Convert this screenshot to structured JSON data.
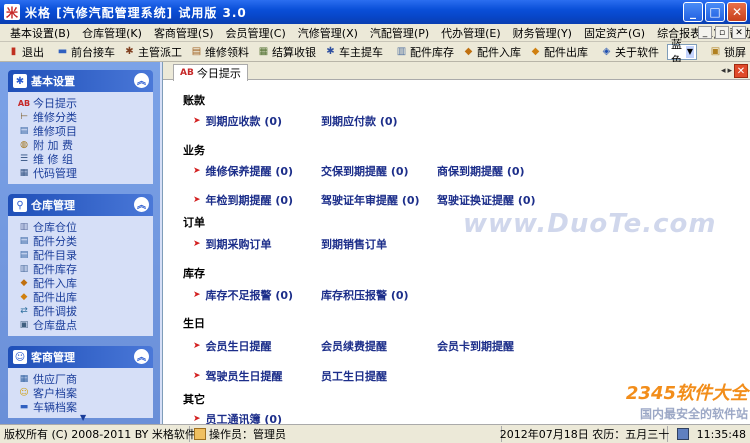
{
  "window": {
    "title": "米格 [汽修汽配管理系统]  试用版  3.0",
    "app_icon": "米"
  },
  "menu": [
    "基本设置(B)",
    "仓库管理(K)",
    "客商管理(S)",
    "会员管理(C)",
    "汽修管理(X)",
    "汽配管理(P)",
    "代办管理(E)",
    "财务管理(Y)",
    "固定资产(G)",
    "综合报表(R)",
    "帮助(H)"
  ],
  "toolbar": {
    "items": [
      "退出",
      "前台接车",
      "主管派工",
      "维修领料",
      "结算收银",
      "车主提车",
      "配件库存",
      "配件入库",
      "配件出库",
      "关于软件"
    ],
    "theme_select": "蓝色",
    "lock": "锁屏"
  },
  "sidebar": {
    "panels": [
      {
        "title": "基本设置",
        "items": [
          "今日提示",
          "维修分类",
          "维修项目",
          "附 加 费",
          "维 修 组",
          "代码管理"
        ]
      },
      {
        "title": "仓库管理",
        "items": [
          "仓库仓位",
          "配件分类",
          "配件目录",
          "配件库存",
          "配件入库",
          "配件出库",
          "配件调拔",
          "仓库盘点"
        ]
      },
      {
        "title": "客商管理",
        "items": [
          "供应厂商",
          "客户档案",
          "车辆档案"
        ]
      }
    ]
  },
  "content": {
    "tab_label": "今日提示",
    "tab_ab": "AB",
    "sections": [
      {
        "title": "账款",
        "links": [
          "到期应收款 (0)",
          "到期应付款 (0)"
        ]
      },
      {
        "title": "业务",
        "links": [
          "维修保养提醒 (0)",
          "交保到期提醒 (0)",
          "商保到期提醒 (0)",
          "年检到期提醒 (0)",
          "驾驶证年审提醒 (0)",
          "驾驶证换证提醒 (0)"
        ]
      },
      {
        "title": "订单",
        "links": [
          "到期采购订单",
          "到期销售订单"
        ]
      },
      {
        "title": "库存",
        "links": [
          "库存不足报警 (0)",
          "库存积压报警 (0)"
        ]
      },
      {
        "title": "生日",
        "links": [
          "会员生日提醒",
          "会员续费提醒",
          "会员卡到期提醒",
          "驾驶员生日提醒",
          "员工生日提醒"
        ]
      },
      {
        "title": "其它",
        "links": [
          "员工通讯簿 (0)"
        ]
      }
    ],
    "watermark": "www.DuoTe.com",
    "brand_top": "2345软件大全",
    "brand_bottom": "国内最安全的软件站"
  },
  "status": {
    "copyright": "版权所有 (C) 2008-2011 BY 米格软件",
    "operator": "操作员：管理员",
    "date": "2012年07月18日  农历：五月三十",
    "time": "11:35:48"
  }
}
